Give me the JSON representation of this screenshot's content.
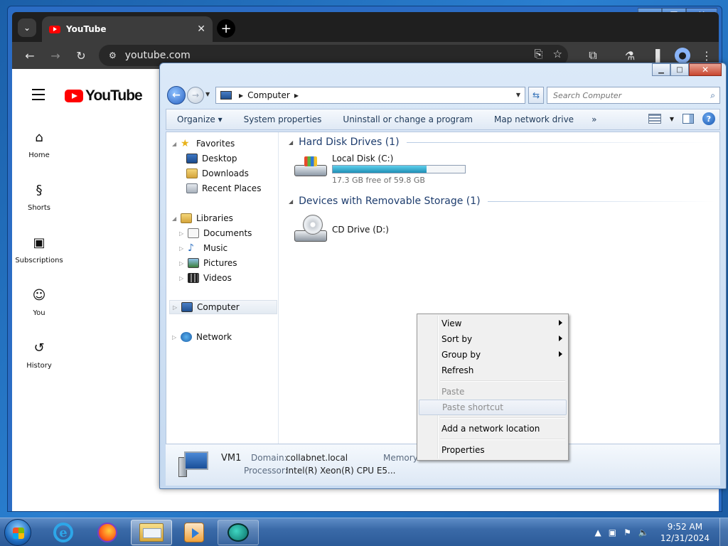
{
  "chrome": {
    "tab_title": "YouTube",
    "tab_close": "✕",
    "new_tab": "+",
    "url": "youtube.com",
    "caption": {
      "minimize": "▁",
      "maximize": "□",
      "close": "✕"
    }
  },
  "youtube": {
    "logo_text": "YouTube",
    "nav": [
      {
        "label": "Home",
        "icon": "home-icon"
      },
      {
        "label": "Shorts",
        "icon": "shorts-icon"
      },
      {
        "label": "Subscriptions",
        "icon": "subscriptions-icon"
      },
      {
        "label": "You",
        "icon": "you-icon"
      },
      {
        "label": "History",
        "icon": "history-icon"
      }
    ]
  },
  "explorer": {
    "address": {
      "crumb": "Computer"
    },
    "search_placeholder": "Search Computer",
    "commands": {
      "organize": "Organize ▾",
      "system_properties": "System properties",
      "uninstall": "Uninstall or change a program",
      "map_drive": "Map network drive",
      "more": "»"
    },
    "nav_pane": {
      "favorites": "Favorites",
      "desktop": "Desktop",
      "downloads": "Downloads",
      "recent_places": "Recent Places",
      "libraries": "Libraries",
      "documents": "Documents",
      "music": "Music",
      "pictures": "Pictures",
      "videos": "Videos",
      "computer": "Computer",
      "network": "Network"
    },
    "groups": {
      "hdd_header": "Hard Disk Drives (1)",
      "removable_header": "Devices with Removable Storage (1)"
    },
    "drives": {
      "c_name": "Local Disk (C:)",
      "c_free": "17.3 GB free of 59.8 GB",
      "c_used_fraction": 0.71,
      "d_name": "CD Drive (D:)"
    },
    "details": {
      "name": "VM1",
      "domain_label": "Domain:",
      "domain_value": "collabnet.local",
      "memory_label": "Memory:",
      "processor_label": "Processor:",
      "processor_value": "Intel(R) Xeon(R) CPU E5..."
    }
  },
  "context_menu": {
    "view": "View",
    "sort_by": "Sort by",
    "group_by": "Group by",
    "refresh": "Refresh",
    "paste": "Paste",
    "paste_shortcut": "Paste shortcut",
    "add_network_location": "Add a network location",
    "properties": "Properties"
  },
  "taskbar": {
    "time": "9:52 AM",
    "date": "12/31/2024"
  }
}
